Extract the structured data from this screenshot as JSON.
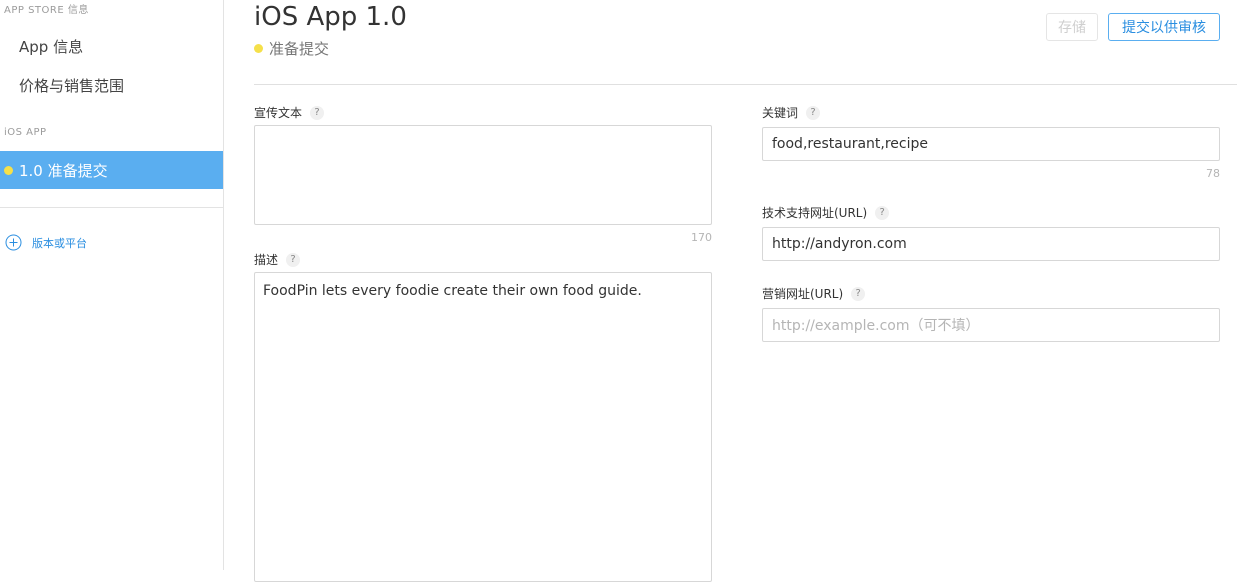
{
  "sidebar": {
    "section_app_store": "APP STORE 信息",
    "items": [
      {
        "label": "App 信息"
      },
      {
        "label": "价格与销售范围"
      }
    ],
    "section_ios": "iOS APP",
    "active_item": "1.0 准备提交",
    "add_version_label": "版本或平台"
  },
  "header": {
    "title": "iOS App 1.0",
    "status": "准备提交",
    "save_button": "存储",
    "submit_button": "提交以供审核"
  },
  "form": {
    "promo_text": {
      "label": "宣传文本",
      "help": "?",
      "value": "",
      "counter": "170"
    },
    "description": {
      "label": "描述",
      "help": "?",
      "value": "FoodPin lets every foodie create their own food guide."
    },
    "keywords": {
      "label": "关键词",
      "help": "?",
      "value": "food,restaurant,recipe",
      "counter": "78"
    },
    "support_url": {
      "label": "技术支持网址(URL)",
      "help": "?",
      "value": "http://andyron.com"
    },
    "marketing_url": {
      "label": "营销网址(URL)",
      "help": "?",
      "value": "",
      "placeholder": "http://example.com（可不填）"
    }
  },
  "colors": {
    "accent": "#5aaef0",
    "link": "#2a8ee0",
    "status_dot": "#f5e04a"
  }
}
